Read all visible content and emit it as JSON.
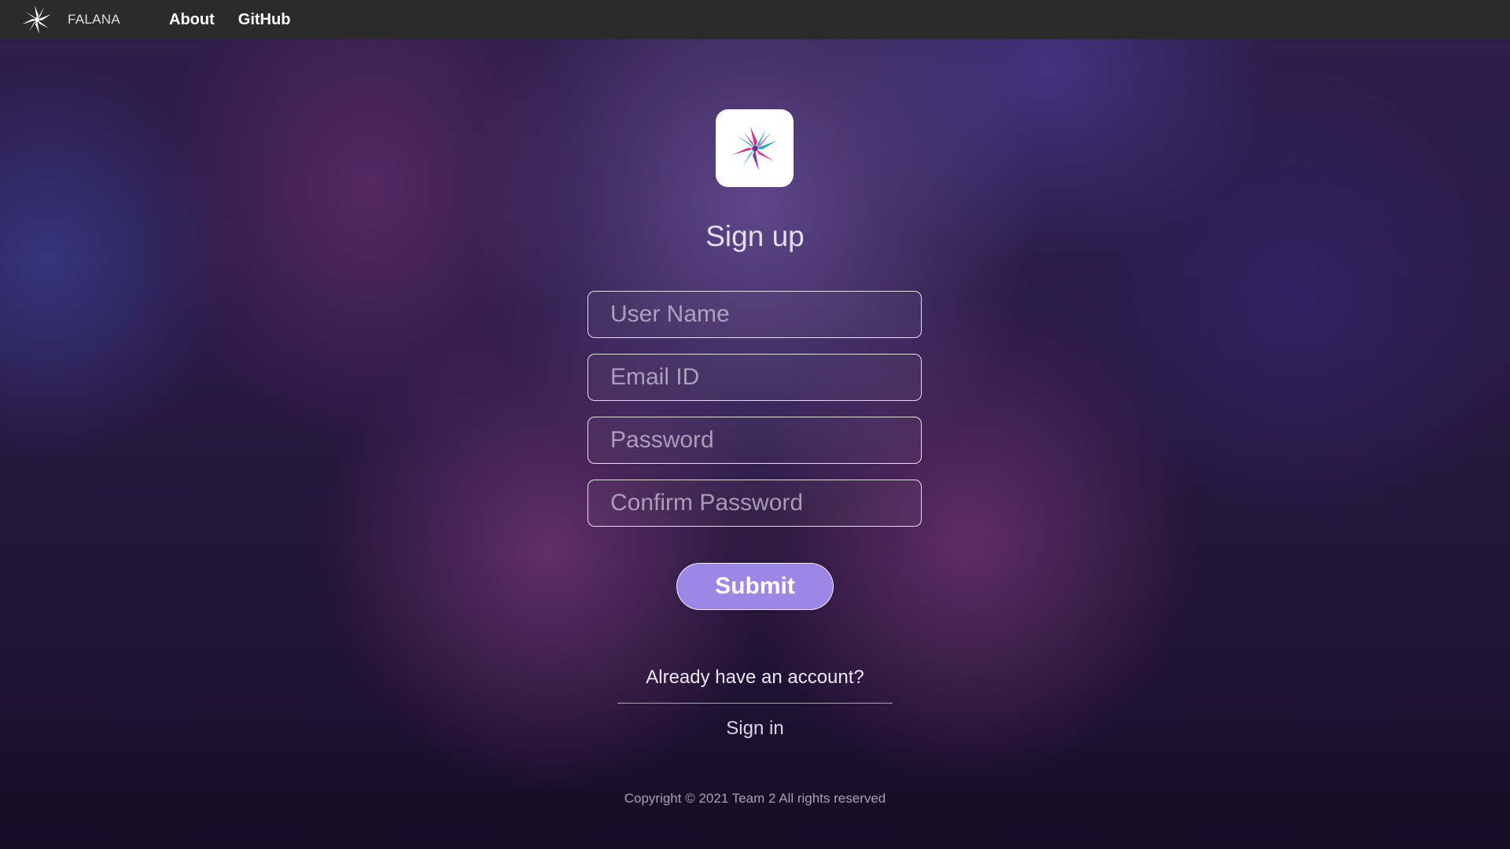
{
  "header": {
    "brand_name": "FALANA",
    "brand_icon": "falana-logo-icon",
    "nav": [
      {
        "label": "About"
      },
      {
        "label": "GitHub"
      }
    ]
  },
  "signup": {
    "app_icon": "falana-flower-logo-icon",
    "title": "Sign up",
    "fields": {
      "username": {
        "placeholder": "User Name",
        "value": ""
      },
      "email": {
        "placeholder": "Email ID",
        "value": ""
      },
      "password": {
        "placeholder": "Password",
        "value": ""
      },
      "confirm_password": {
        "placeholder": "Confirm Password",
        "value": ""
      }
    },
    "submit_label": "Submit",
    "already_text": "Already have an account?",
    "signin_label": "Sign in"
  },
  "footer": {
    "copyright": "Copyright © 2021 Team 2 All rights reserved"
  },
  "colors": {
    "topbar": "#2b2b2b",
    "submit_button": "#9a87e6",
    "background_dark": "#1f1233",
    "background_purple": "#6e55a0"
  }
}
